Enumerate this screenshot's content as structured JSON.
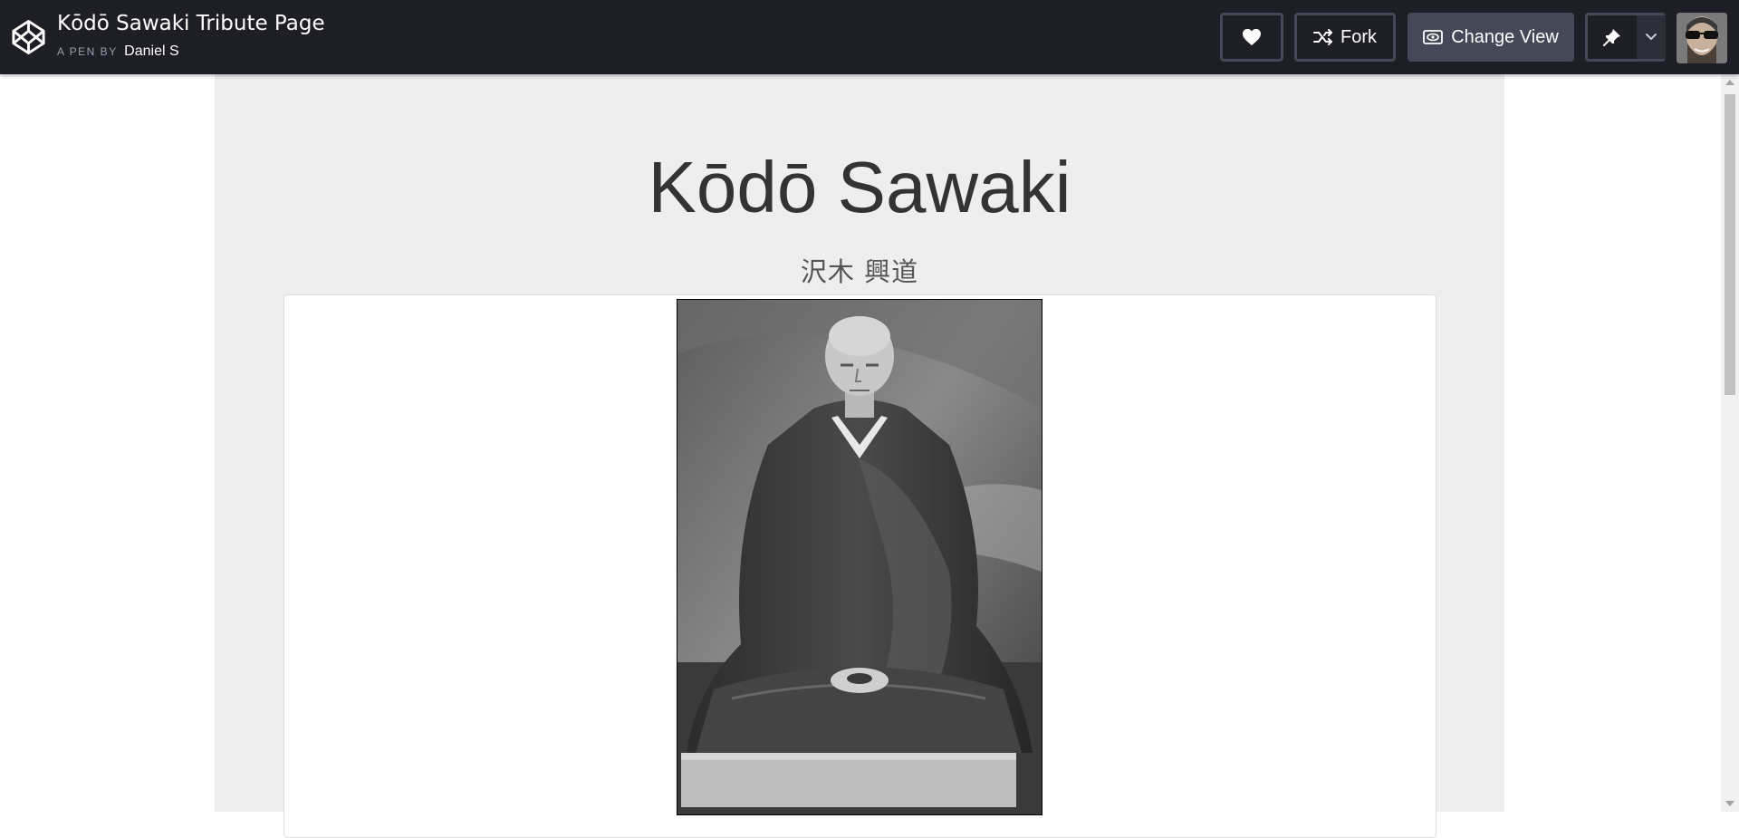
{
  "header": {
    "pen_title": "Kōdō Sawaki Tribute Page",
    "pen_by_label": "A PEN BY",
    "author": "Daniel S",
    "buttons": {
      "heart_icon": "heart-icon",
      "fork_label": "Fork",
      "change_view_label": "Change View",
      "pin_icon": "pin-icon",
      "dropdown_icon": "chevron-down-icon"
    }
  },
  "content": {
    "title": "Kōdō Sawaki",
    "subtitle": "沢木 興道"
  },
  "colors": {
    "topbar_bg": "#1e1f26",
    "button_border": "#444857",
    "page_bg": "#eeeeee",
    "card_bg": "#ffffff",
    "title_text": "#333333"
  }
}
